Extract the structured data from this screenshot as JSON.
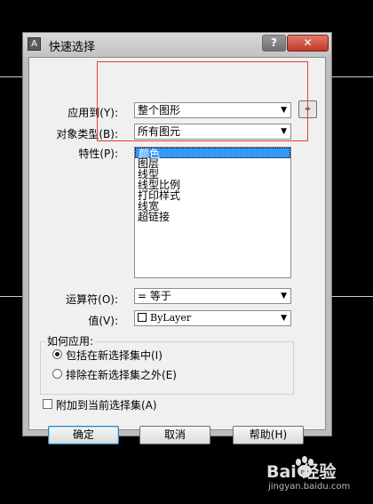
{
  "window": {
    "title": "快速选择",
    "help_button": "?",
    "close_button": "✕"
  },
  "form": {
    "apply_to": {
      "label": "应用到(Y):",
      "value": "整个图形"
    },
    "object_type": {
      "label": "对象类型(B):",
      "value": "所有图元"
    },
    "properties": {
      "label": "特性(P):",
      "items": [
        "颜色",
        "图层",
        "线型",
        "线型比例",
        "打印样式",
        "线宽",
        "超链接"
      ],
      "selected_index": 0
    },
    "operator": {
      "label": "运算符(O):",
      "value": "= 等于"
    },
    "value": {
      "label": "值(V):",
      "value": "ByLayer"
    },
    "how_to_apply": {
      "title": "如何应用:",
      "include": "包括在新选择集中(I)",
      "exclude": "排除在新选择集之外(E)",
      "selected": "include"
    },
    "append_checkbox": "附加到当前选择集(A)"
  },
  "buttons": {
    "ok": "确定",
    "cancel": "取消",
    "help": "帮助(H)"
  },
  "watermark": {
    "logo": "Bai 经验",
    "url": "jingyan.baidu.com"
  }
}
